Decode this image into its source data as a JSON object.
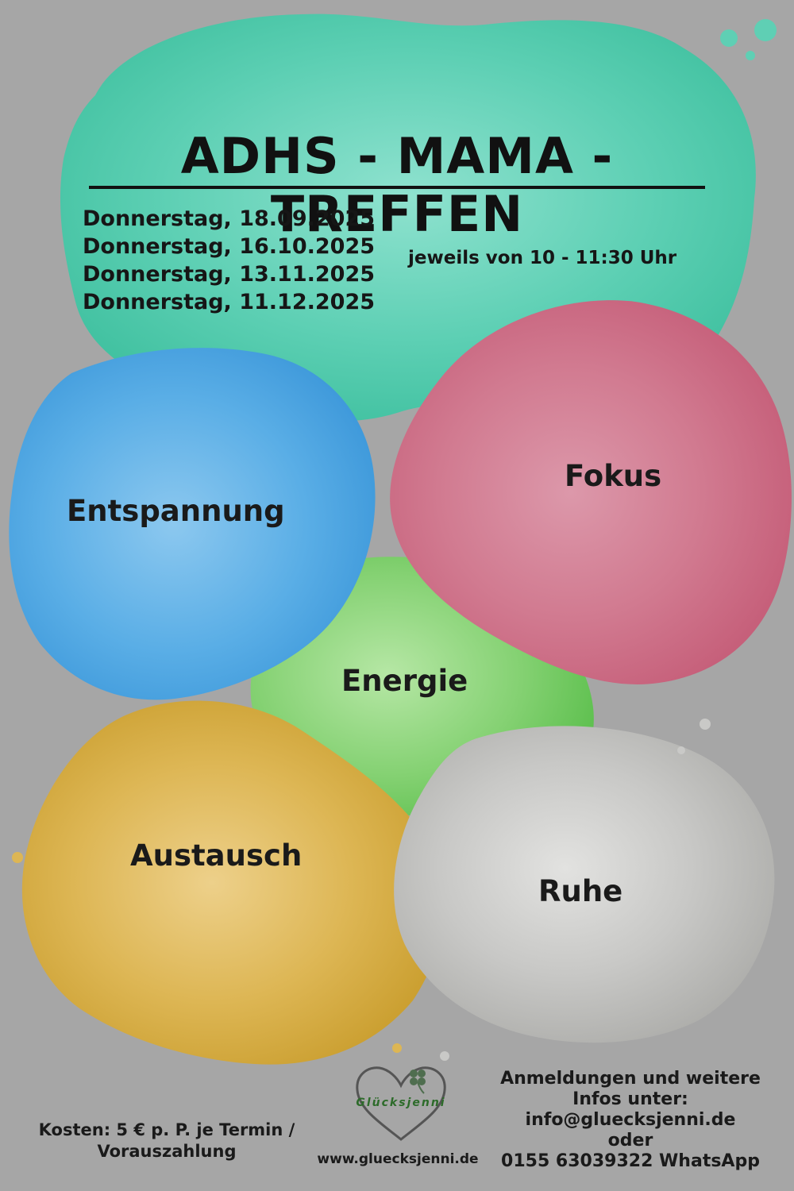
{
  "title": "ADHS - MAMA - TREFFEN",
  "dates": [
    "Donnerstag, 18.09.2025",
    "Donnerstag, 16.10.2025",
    "Donnerstag, 13.11.2025",
    "Donnerstag, 11.12.2025"
  ],
  "time_note": "jeweils von 10 - 11:30 Uhr",
  "topics": {
    "relaxation": "Entspannung",
    "focus": "Fokus",
    "energy": "Energie",
    "exchange": "Austausch",
    "calm": "Ruhe"
  },
  "cost": "Kosten: 5 € p. P. je Termin / Vorauszahlung",
  "brand": {
    "name": "Glücksjenni",
    "website": "www.gluecksjenni.de"
  },
  "contact": {
    "line1": "Anmeldungen und weitere",
    "line2": "Infos unter:",
    "email": "info@gluecksjenni.de",
    "or": "oder",
    "phone": "0155 63039322 WhatsApp"
  },
  "colors": {
    "background": "#a6a6a6",
    "teal": "#5fcfb4",
    "blue": "#54a9e4",
    "pink": "#d2788e",
    "green": "#7fd070",
    "yellow": "#d9b34d",
    "gray": "#c9c9c7",
    "heart_outline": "#555555",
    "clover": "#4f6e4f"
  }
}
